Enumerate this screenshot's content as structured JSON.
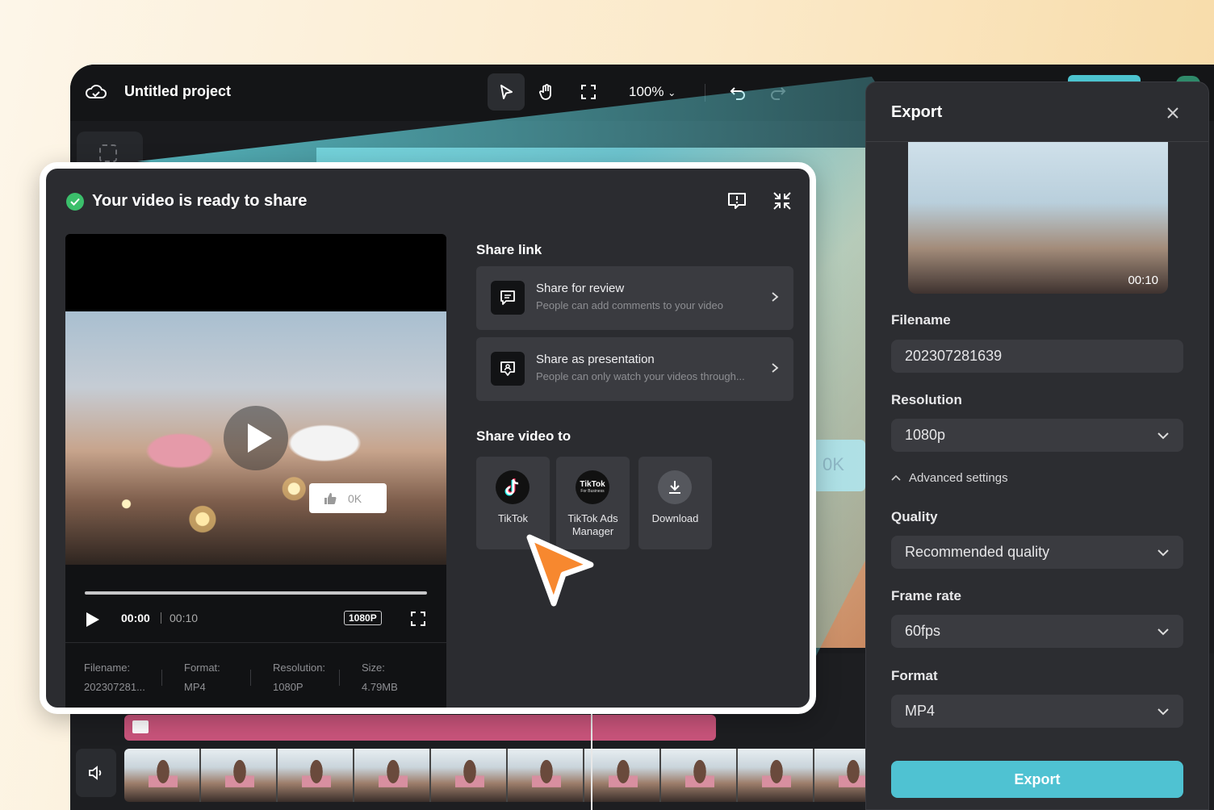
{
  "editor": {
    "project_title": "Untitled project",
    "zoom": "100%",
    "canvas_like_text": "0K"
  },
  "share_modal": {
    "title": "Your video is ready to share",
    "player": {
      "current_time": "00:00",
      "total_time": "00:10",
      "resolution_badge": "1080P",
      "like_count": "0K"
    },
    "meta": [
      {
        "label": "Filename:",
        "value": "202307281..."
      },
      {
        "label": "Format:",
        "value": "MP4"
      },
      {
        "label": "Resolution:",
        "value": "1080P"
      },
      {
        "label": "Size:",
        "value": "4.79MB"
      }
    ],
    "share_link_title": "Share link",
    "share_links": [
      {
        "title": "Share for review",
        "subtitle": "People can add comments to your video",
        "icon": "comment-icon"
      },
      {
        "title": "Share as presentation",
        "subtitle": "People can only watch your videos through...",
        "icon": "presentation-icon"
      }
    ],
    "share_video_title": "Share video to",
    "targets": [
      {
        "label": "TikTok",
        "icon": "tiktok-icon"
      },
      {
        "label": "TikTok Ads Manager",
        "icon": "tiktok-business-icon",
        "logo_text": "TikTok",
        "logo_sub": "For Business"
      },
      {
        "label": "Download",
        "icon": "download-icon"
      }
    ]
  },
  "export_panel": {
    "title": "Export",
    "thumb_time": "00:10",
    "filename_label": "Filename",
    "filename_value": "202307281639",
    "resolution_label": "Resolution",
    "resolution_value": "1080p",
    "advanced_label": "Advanced settings",
    "quality_label": "Quality",
    "quality_value": "Recommended quality",
    "framerate_label": "Frame rate",
    "framerate_value": "60fps",
    "format_label": "Format",
    "format_value": "MP4",
    "export_button": "Export"
  },
  "colors": {
    "accent": "#4fc2d2",
    "success": "#3bbf6b",
    "cursor": "#f7882f",
    "track_pink": "#c9547b"
  }
}
